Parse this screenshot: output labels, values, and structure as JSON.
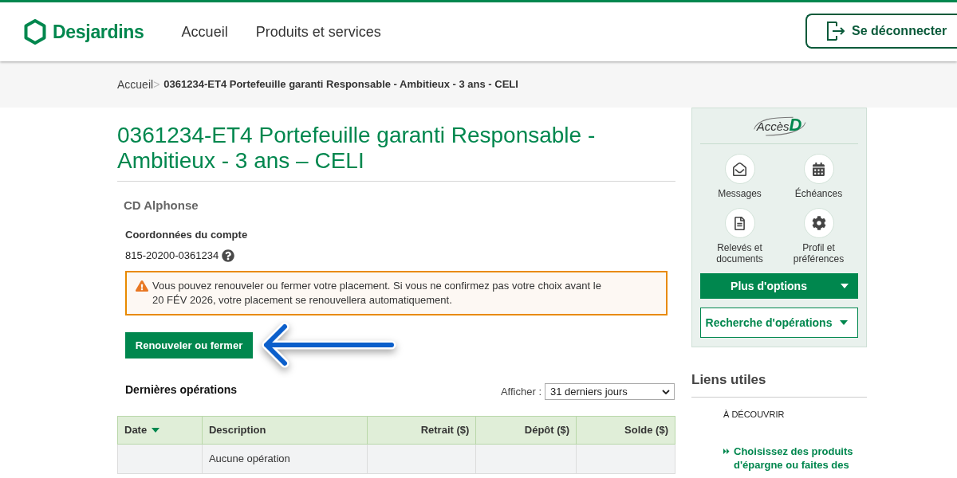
{
  "header": {
    "logo": "Desjardins",
    "nav": [
      {
        "label": "Accueil"
      },
      {
        "label": "Produits et services"
      }
    ],
    "logout_button": "Se déconnecter"
  },
  "breadcrumb": {
    "separator": ">",
    "items": [
      {
        "label": "Accueil",
        "current": false
      },
      {
        "label": "0361234-ET4 Portefeuille garanti Responsable - Ambitieux - 3 ans - CELI",
        "current": true
      }
    ]
  },
  "page_title": "0361234-ET4 Portefeuille garanti Responsable - Ambitieux - 3 ans – CELI",
  "holder": "CD Alphonse",
  "account": {
    "heading": "Coordonnées du compte",
    "number": "815-20200-0361234"
  },
  "alert": {
    "kind": "warning",
    "text": "Vous pouvez renouveler ou fermer votre placement. Si vous ne confirmez pas votre choix avant le 20 FÉV 2026, votre placement se renouvellera automatiquement."
  },
  "primary_action": "Renouveler ou fermer",
  "operations": {
    "title": "Dernières opérations",
    "filter_label": "Afficher :",
    "filter_value": "31 derniers jours",
    "columns": [
      {
        "label": "Date",
        "sorted": true
      },
      {
        "label": "Description",
        "sorted": false
      },
      {
        "label": "Retrait ($)",
        "sorted": false
      },
      {
        "label": "Dépôt ($)",
        "sorted": false
      },
      {
        "label": "Solde ($)",
        "sorted": false
      }
    ],
    "empty_message": "Aucune opération"
  },
  "sidebar": {
    "logo_word": "Accès",
    "logo_letter": "D",
    "shortcuts": [
      {
        "label": "Messages"
      },
      {
        "label": "Échéances"
      },
      {
        "label": "Relevés et documents"
      },
      {
        "label": "Profil et préférences"
      }
    ],
    "menu_buttons": [
      {
        "kind": "filled",
        "label": "Plus d'options"
      },
      {
        "kind": "outline",
        "label": "Recherche d'opérations"
      }
    ]
  },
  "useful_links": {
    "title": "Liens utiles",
    "section": "À DÉCOUVRIR",
    "links": [
      "Choisissez des produits d'épargne ou faites des"
    ]
  }
}
